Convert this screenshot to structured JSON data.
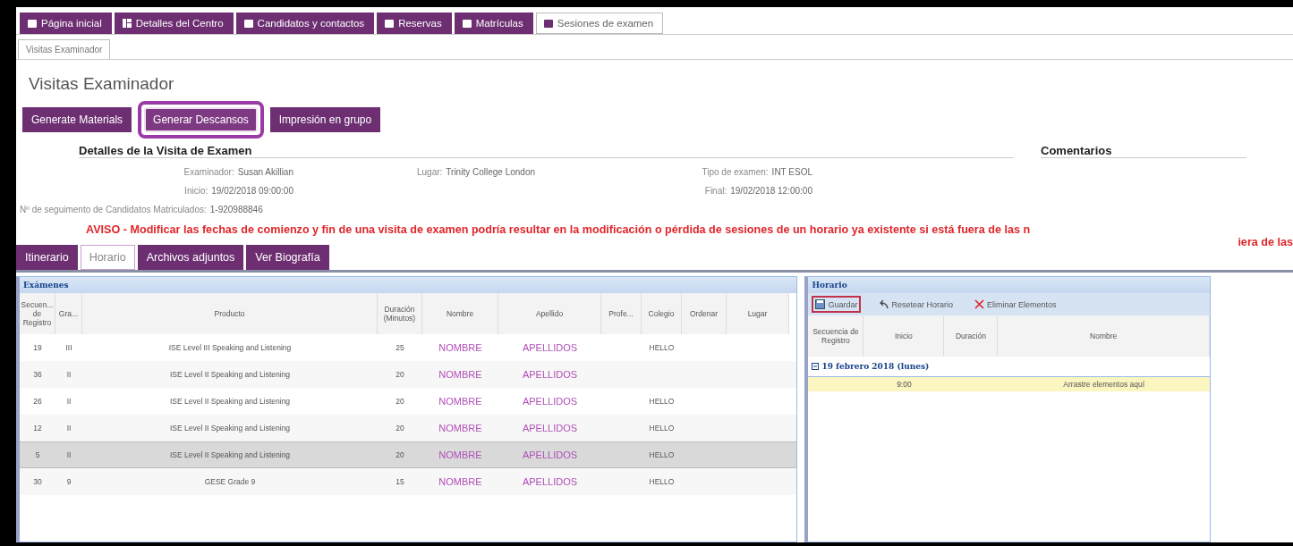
{
  "top_tabs": [
    {
      "label": "Página inicial",
      "selected": false,
      "kind": "square"
    },
    {
      "label": "Detalles del Centro",
      "selected": false,
      "kind": "grid"
    },
    {
      "label": "Candidatos y contactos",
      "selected": false,
      "kind": "square"
    },
    {
      "label": "Reservas",
      "selected": false,
      "kind": "square"
    },
    {
      "label": "Matrículas",
      "selected": false,
      "kind": "square"
    },
    {
      "label": "Sesiones de examen",
      "selected": true,
      "kind": "square"
    }
  ],
  "sub_tabs": [
    {
      "label": "Visitas Examinador",
      "selected": true
    }
  ],
  "title": "Visitas Examinador",
  "action_buttons": [
    {
      "label": "Generate Materials",
      "highlighted": false
    },
    {
      "label": "Generar Descansos",
      "highlighted": true
    },
    {
      "label": "Impresión en grupo",
      "highlighted": false
    }
  ],
  "details": {
    "heading": "Detalles de la Visita de Examen",
    "comments_heading": "Comentarios",
    "rows": [
      [
        {
          "label": "Examinador:",
          "value": "Susan Akillian"
        },
        {
          "label": "Lugar:",
          "value": "Trinity College London"
        },
        {
          "label": "Tipo de examen:",
          "value": "INT ESOL"
        }
      ],
      [
        {
          "label": "Inicio:",
          "value": "19/02/2018 09:00:00"
        },
        null,
        {
          "label": "Final:",
          "value": "19/02/2018 12:00:00"
        }
      ],
      [
        {
          "label": "Nº de seguimento de Candidatos Matriculados:",
          "value": "1-920988846"
        }
      ]
    ]
  },
  "warning": "AVISO - Modificar las fechas de comienzo y fin de una visita de examen podría resultar en la modificación o pérdida de sesiones de un horario ya existente si está fuera de las n",
  "warning_overflow": "iera de las",
  "bottom_tabs": [
    {
      "label": "Itinerario",
      "selected": false
    },
    {
      "label": "Horario",
      "selected": true
    },
    {
      "label": "Archivos adjuntos",
      "selected": false
    },
    {
      "label": "Ver Biografía",
      "selected": false
    }
  ],
  "exams": {
    "title": "Exámenes",
    "columns": [
      "Secuen... de Registro",
      "Gra...",
      "Producto",
      "Duración (Minutos)",
      "Nombre",
      "Apellido",
      "Profe...",
      "Colegio",
      "Ordenar",
      "Lugar"
    ],
    "rows": [
      {
        "selected": false,
        "cells": [
          "19",
          "III",
          "ISE Level III Speaking and Listening",
          "25",
          "NOMBRE",
          "APELLIDOS",
          "",
          "HELLO",
          "",
          ""
        ]
      },
      {
        "selected": false,
        "cells": [
          "36",
          "II",
          "ISE Level II Speaking and Listening",
          "20",
          "NOMBRE",
          "APELLIDOS",
          "",
          "",
          "",
          ""
        ]
      },
      {
        "selected": false,
        "cells": [
          "26",
          "II",
          "ISE Level II Speaking and Listening",
          "20",
          "NOMBRE",
          "APELLIDOS",
          "",
          "HELLO",
          "",
          ""
        ]
      },
      {
        "selected": false,
        "cells": [
          "12",
          "II",
          "ISE Level II Speaking and Listening",
          "20",
          "NOMBRE",
          "APELLIDOS",
          "",
          "HELLO",
          "",
          ""
        ]
      },
      {
        "selected": true,
        "cells": [
          "5",
          "II",
          "ISE Level II Speaking and Listening",
          "20",
          "NOMBRE",
          "APELLIDOS",
          "",
          "HELLO",
          "",
          ""
        ]
      },
      {
        "selected": false,
        "cells": [
          "30",
          "9",
          "GESE Grade 9",
          "15",
          "NOMBRE",
          "APELLIDOS",
          "",
          "HELLO",
          "",
          ""
        ]
      }
    ]
  },
  "schedule": {
    "title": "Horario",
    "toolbar": [
      {
        "label": "Guardar",
        "kind": "save",
        "focused": true
      },
      {
        "label": "Resetear Horario",
        "kind": "undo",
        "focused": false
      },
      {
        "label": "Eliminar Elementos",
        "kind": "delete",
        "focused": false
      }
    ],
    "columns": [
      "Secuencia de Registro",
      "Inicio",
      "Duración",
      "Nombre"
    ],
    "group": "19 febrero 2018 (lunes)",
    "rows": [
      {
        "cells": [
          "",
          "9:00",
          "",
          "Arrastre elementos aquí"
        ]
      }
    ]
  }
}
